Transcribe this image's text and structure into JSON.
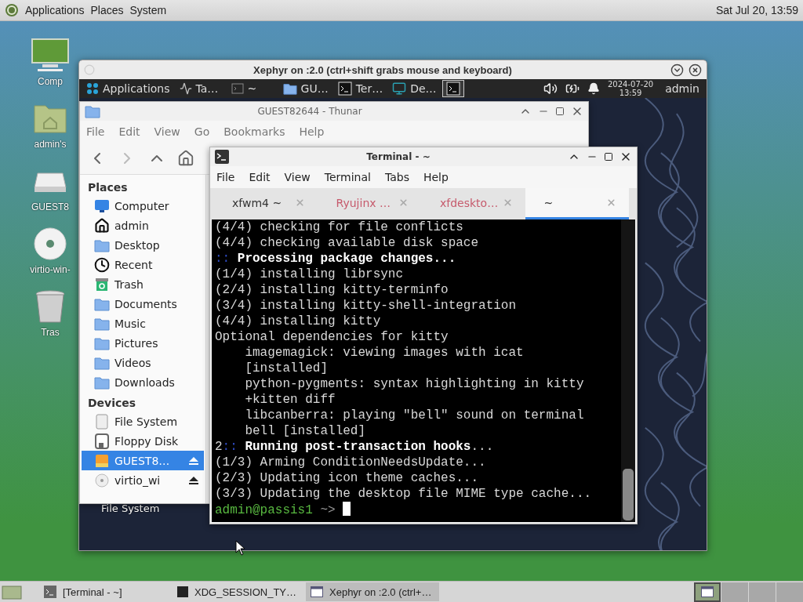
{
  "top_panel": {
    "menus": [
      "Applications",
      "Places",
      "System"
    ],
    "clock": "Sat Jul 20, 13:59"
  },
  "desktop_icons": [
    {
      "label": "Comp",
      "kind": "computer"
    },
    {
      "label": "admin's",
      "kind": "home"
    },
    {
      "label": "GUEST8",
      "kind": "drive"
    },
    {
      "label": "virtio-win-",
      "kind": "disc"
    },
    {
      "label": "Tras",
      "kind": "trash"
    }
  ],
  "xephyr": {
    "title": "Xephyr on :2.0 (ctrl+shift grabs mouse and keyboard)",
    "panel": {
      "menu": "Applications",
      "tasks": [
        {
          "label": "Ta…",
          "kind": "monitor",
          "selected": false
        },
        {
          "label": "~",
          "kind": "terminal-outline",
          "selected": false
        },
        {
          "label": "GU…",
          "kind": "folder",
          "selected": false
        },
        {
          "label": "Ter…",
          "kind": "terminal",
          "selected": false
        },
        {
          "label": "De…",
          "kind": "display",
          "selected": false
        },
        {
          "kind": "terminal",
          "selected": true
        }
      ],
      "date": "2024-07-20",
      "time": "13:59",
      "user": "admin"
    },
    "desktop_label": "File System",
    "thunar": {
      "title": "GUEST82644 - Thunar",
      "menu": [
        "File",
        "Edit",
        "View",
        "Go",
        "Bookmarks",
        "Help"
      ],
      "sections": [
        {
          "heading": "Places",
          "items": [
            {
              "label": "Computer",
              "kind": "computer",
              "selected": false
            },
            {
              "label": "admin",
              "kind": "home",
              "selected": false
            },
            {
              "label": "Desktop",
              "kind": "folder",
              "selected": false
            },
            {
              "label": "Recent",
              "kind": "recent",
              "selected": false
            },
            {
              "label": "Trash",
              "kind": "trash",
              "selected": false
            },
            {
              "label": "Documents",
              "kind": "folder",
              "selected": false
            },
            {
              "label": "Music",
              "kind": "folder",
              "selected": false
            },
            {
              "label": "Pictures",
              "kind": "folder",
              "selected": false
            },
            {
              "label": "Videos",
              "kind": "folder",
              "selected": false
            },
            {
              "label": "Downloads",
              "kind": "folder",
              "selected": false
            }
          ]
        },
        {
          "heading": "Devices",
          "items": [
            {
              "label": "File System",
              "kind": "drive",
              "selected": false
            },
            {
              "label": "Floppy Disk",
              "kind": "floppy",
              "selected": false
            },
            {
              "label": "GUEST8…",
              "kind": "usb",
              "selected": true,
              "eject": true
            },
            {
              "label": "virtio_wi",
              "kind": "disc",
              "selected": false,
              "eject": true
            }
          ]
        }
      ]
    },
    "terminal": {
      "title": "Terminal - ~",
      "menu": [
        "File",
        "Edit",
        "View",
        "Terminal",
        "Tabs",
        "Help"
      ],
      "tabs": [
        {
          "label": "xfwm4 ~",
          "selected": false,
          "activity": false
        },
        {
          "label": "Ryujinx …",
          "selected": false,
          "activity": true
        },
        {
          "label": "xfdeskto…",
          "selected": false,
          "activity": true
        },
        {
          "label": "~",
          "selected": true,
          "activity": false
        }
      ],
      "lines": [
        [
          {
            "text": "(4/4) checking for file conflicts",
            "kind": "normal"
          }
        ],
        [
          {
            "text": "(4/4) checking available disk space",
            "kind": "normal"
          }
        ],
        [
          {
            "text": ":: ",
            "kind": "accent"
          },
          {
            "text": "Processing package changes...",
            "kind": "bold"
          }
        ],
        [
          {
            "text": "(1/4) installing librsync",
            "kind": "normal"
          }
        ],
        [
          {
            "text": "(2/4) installing kitty-terminfo",
            "kind": "normal"
          }
        ],
        [
          {
            "text": "(3/4) installing kitty-shell-integration",
            "kind": "normal"
          }
        ],
        [
          {
            "text": "(4/4) installing kitty",
            "kind": "normal"
          }
        ],
        [
          {
            "text": "Optional dependencies for kitty",
            "kind": "normal"
          }
        ],
        [
          {
            "text": "    imagemagick: viewing images with icat",
            "kind": "normal"
          }
        ],
        [
          {
            "text": "    [installed]",
            "kind": "normal"
          }
        ],
        [
          {
            "text": "    python-pygments: syntax highlighting in kitty",
            "kind": "normal"
          }
        ],
        [
          {
            "text": "    +kitten diff",
            "kind": "normal"
          }
        ],
        [
          {
            "text": "    libcanberra: playing \"bell\" sound on terminal",
            "kind": "normal"
          }
        ],
        [
          {
            "text": "    bell [installed]",
            "kind": "normal"
          }
        ],
        [
          {
            "text": "2",
            "kind": "normal"
          },
          {
            "text": ":: ",
            "kind": "accent"
          },
          {
            "text": "Running post-transaction hooks",
            "kind": "bold"
          },
          {
            "text": "...",
            "kind": "normal"
          }
        ],
        [
          {
            "text": "(1/3) Arming ConditionNeedsUpdate...",
            "kind": "normal"
          }
        ],
        [
          {
            "text": "(2/3) Updating icon theme caches...",
            "kind": "normal"
          }
        ],
        [
          {
            "text": "(3/3) Updating the desktop file MIME type cache...",
            "kind": "normal"
          }
        ]
      ],
      "prompt": {
        "user": "admin@passis1",
        "arrow": " ~> ",
        "cursor": true
      }
    }
  },
  "taskbar": {
    "tasks": [
      {
        "label": "[Terminal - ~]",
        "kind": "terminal",
        "selected": false
      },
      {
        "label": "XDG_SESSION_TY…",
        "kind": "console",
        "selected": false
      },
      {
        "label": "Xephyr on :2.0 (ctrl+…",
        "kind": "window",
        "selected": true
      }
    ],
    "workspaces": [
      {
        "selected": true
      },
      {
        "selected": false
      },
      {
        "selected": false
      },
      {
        "selected": false
      }
    ]
  }
}
